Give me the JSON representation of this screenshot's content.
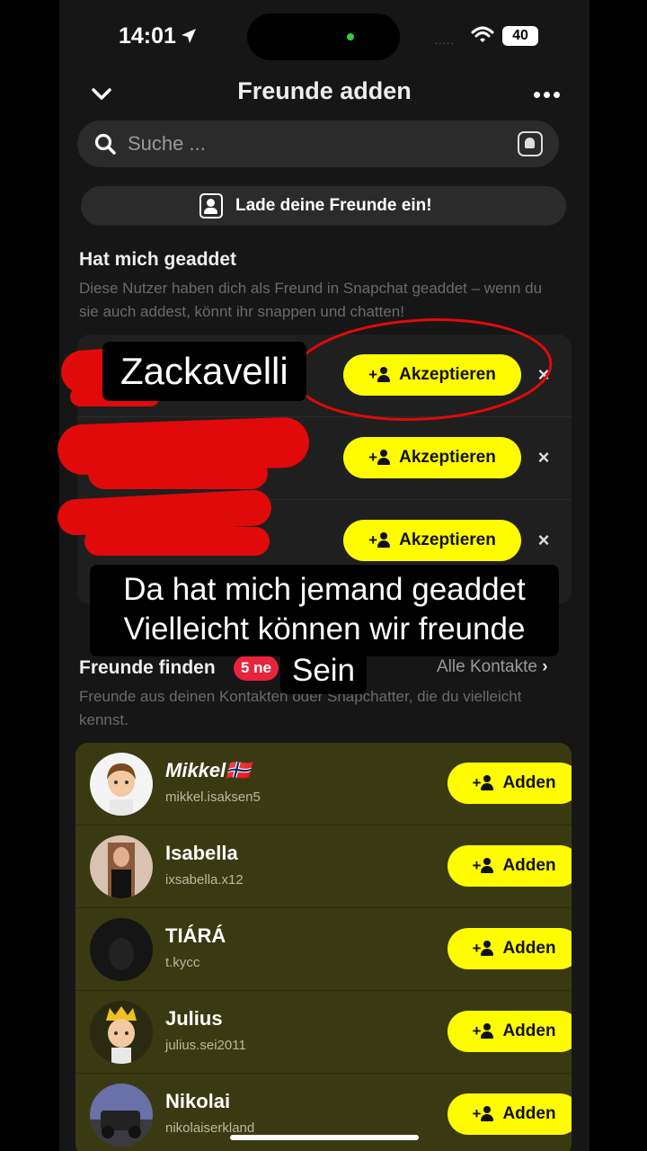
{
  "status": {
    "time": "14:01",
    "signal": ".....",
    "battery": "40"
  },
  "header": {
    "title": "Freunde adden"
  },
  "search": {
    "placeholder": "Suche ..."
  },
  "invite": {
    "label": "Lade deine Freunde ein!"
  },
  "added_me": {
    "title": "Hat mich geaddet",
    "description": "Diese Nutzer haben dich als Freund in Snapchat geaddet – wenn du sie auch addest, könnt ihr snappen und chatten!",
    "accept_label": "Akzeptieren",
    "rows": [
      {},
      {},
      {}
    ]
  },
  "overlay": {
    "name_caption": "Zackavelli",
    "caption_line1": "Da hat mich jemand geaddet",
    "caption_line2": "Vielleicht können wir freunde",
    "caption_line3": "Sein"
  },
  "find_friends": {
    "title": "Freunde finden",
    "badge": "5 ne",
    "all_contacts": "Alle Kontakte",
    "description": "Freunde aus deinen Kontakten oder Snapchatter, die du vielleicht kennst.",
    "add_label": "Adden",
    "suggestions": [
      {
        "name": "Mikkel🇳🇴",
        "username": "mikkel.isaksen5"
      },
      {
        "name": "Isabella",
        "username": "ixsabella.x12"
      },
      {
        "name": "TIÁRÁ",
        "username": "t.kycc"
      },
      {
        "name": "Julius",
        "username": "julius.sei2011"
      },
      {
        "name": "Nikolai",
        "username": "nikolaiserkland"
      }
    ]
  },
  "colors": {
    "accent": "#fffc00",
    "badge": "#e8243c",
    "scribble": "#e00a0a"
  }
}
